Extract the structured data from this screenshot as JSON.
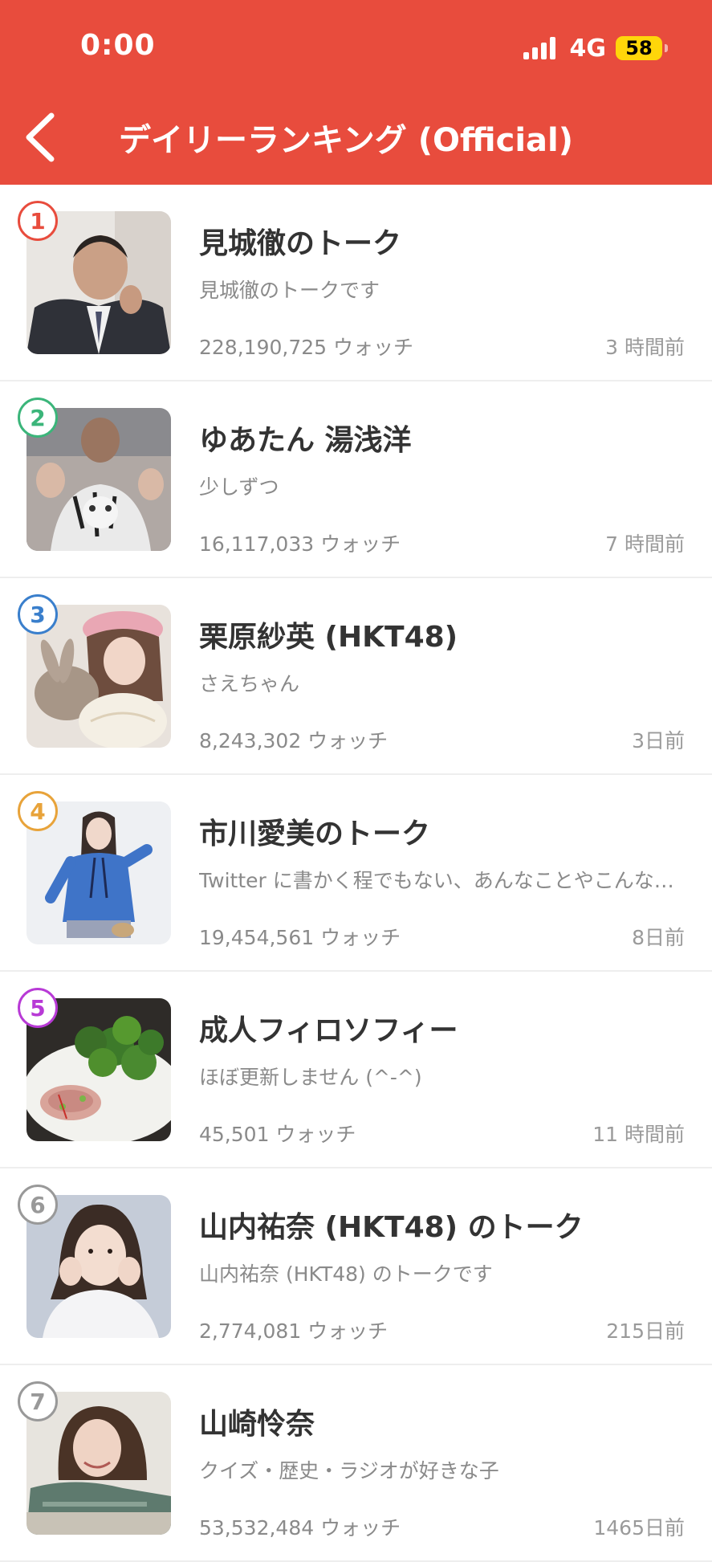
{
  "status_bar": {
    "time": "0:00",
    "network": "4G",
    "battery": "58"
  },
  "header": {
    "title": "デイリーランキング (Official)"
  },
  "colors": {
    "header_bg": "#E84C3D",
    "rank_colors": [
      "#E84C3D",
      "#3BB57A",
      "#3A7FCC",
      "#E8A33A",
      "#B83AD6",
      "#999999",
      "#999999"
    ]
  },
  "items": [
    {
      "rank": "1",
      "name": "見城徹のトーク",
      "description": "見城徹のトークです",
      "watchers": "228,190,725 ウォッチ",
      "time": "3 時間前"
    },
    {
      "rank": "2",
      "name": "ゆあたん 湯浅洋",
      "description": "少しずつ",
      "watchers": "16,117,033 ウォッチ",
      "time": "7 時間前"
    },
    {
      "rank": "3",
      "name": "栗原紗英 (HKT48)",
      "description": "さえちゃん",
      "watchers": "8,243,302 ウォッチ",
      "time": "3日前"
    },
    {
      "rank": "4",
      "name": "市川愛美のトーク",
      "description": "Twitter に書かく程でもない、あんなことやこんなこと",
      "watchers": "19,454,561 ウォッチ",
      "time": "8日前"
    },
    {
      "rank": "5",
      "name": "成人フィロソフィー",
      "description": "ほぼ更新しません (^-^)",
      "watchers": "45,501 ウォッチ",
      "time": "11 時間前"
    },
    {
      "rank": "6",
      "name": "山内祐奈 (HKT48) のトーク",
      "description": "山内祐奈 (HKT48) のトークです",
      "watchers": "2,774,081 ウォッチ",
      "time": "215日前"
    },
    {
      "rank": "7",
      "name": "山崎怜奈",
      "description": "クイズ・歴史・ラジオが好きな子",
      "watchers": "53,532,484 ウォッチ",
      "time": "1465日前"
    }
  ]
}
